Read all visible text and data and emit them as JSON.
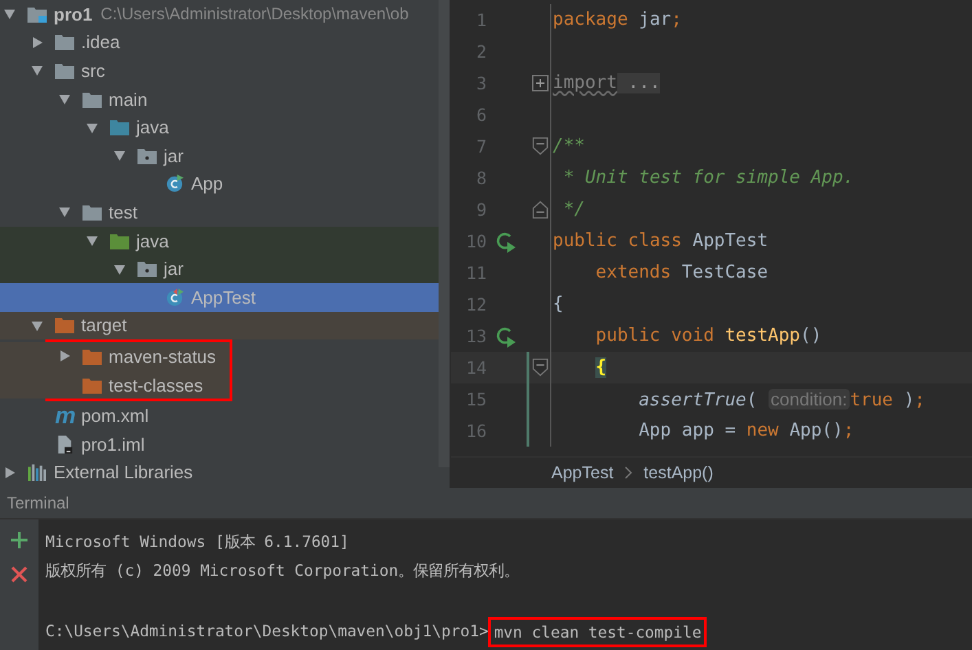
{
  "tree": [
    {
      "label": "pro1",
      "path": "C:\\Users\\Administrator\\Desktop\\maven\\ob",
      "kind": "module",
      "expanded": true,
      "selected": false,
      "children": [
        {
          "label": ".idea",
          "kind": "folder",
          "expanded": false,
          "selected": false
        },
        {
          "label": "src",
          "kind": "folder",
          "expanded": true,
          "selected": false,
          "children": [
            {
              "label": "main",
              "kind": "folder",
              "expanded": true,
              "selected": false,
              "children": [
                {
                  "label": "java",
                  "kind": "source-root",
                  "expanded": true,
                  "selected": false,
                  "children": [
                    {
                      "label": "jar",
                      "kind": "package",
                      "expanded": true,
                      "selected": false,
                      "children": [
                        {
                          "label": "App",
                          "kind": "class",
                          "selected": false
                        }
                      ]
                    }
                  ]
                }
              ]
            },
            {
              "label": "test",
              "kind": "folder",
              "expanded": true,
              "selected": false,
              "children": [
                {
                  "label": "java",
                  "kind": "test-root",
                  "expanded": true,
                  "selected": false,
                  "children": [
                    {
                      "label": "jar",
                      "kind": "package",
                      "expanded": true,
                      "selected": false,
                      "children": [
                        {
                          "label": "AppTest",
                          "kind": "test-class",
                          "selected": true
                        }
                      ]
                    }
                  ]
                }
              ]
            }
          ]
        },
        {
          "label": "target",
          "kind": "excluded",
          "expanded": true,
          "selected": false,
          "children": [
            {
              "label": "maven-status",
              "kind": "excluded",
              "expanded": false,
              "selected": false,
              "boxed": true
            },
            {
              "label": "test-classes",
              "kind": "excluded",
              "selected": false,
              "boxed": true
            }
          ]
        },
        {
          "label": "pom.xml",
          "kind": "maven",
          "glyph": "m",
          "selected": false
        },
        {
          "label": "pro1.iml",
          "kind": "file",
          "selected": false
        }
      ]
    },
    {
      "label": "External Libraries",
      "kind": "libraries",
      "expanded": false,
      "selected": false
    }
  ],
  "editor": {
    "lines": [
      {
        "number": "1",
        "run": false,
        "current": false,
        "changed": false,
        "tokens": [
          {
            "text": "package ",
            "kind": "keyword"
          },
          {
            "text": "jar",
            "kind": "plain"
          },
          {
            "text": ";",
            "kind": "keyword"
          }
        ]
      },
      {
        "number": "2",
        "run": false,
        "current": false,
        "changed": false
      },
      {
        "number": "3",
        "run": false,
        "current": false,
        "changed": false,
        "fold": {
          "kind": "collapsed"
        },
        "tokens": [
          {
            "text": "import",
            "kind": "unused"
          },
          {
            "text": " ...",
            "kind": "folded"
          }
        ]
      },
      {
        "number": "6",
        "run": false,
        "current": false,
        "changed": false
      },
      {
        "number": "7",
        "run": false,
        "current": false,
        "changed": false,
        "fold": {
          "kind": "start"
        },
        "tokens": [
          {
            "text": "/**",
            "kind": "doc"
          }
        ]
      },
      {
        "number": "8",
        "run": false,
        "current": false,
        "changed": false,
        "tokens": [
          {
            "text": " * Unit test for simple App.",
            "kind": "doc"
          }
        ]
      },
      {
        "number": "9",
        "run": false,
        "current": false,
        "changed": false,
        "fold": {
          "kind": "end"
        },
        "tokens": [
          {
            "text": " */",
            "kind": "doc"
          }
        ]
      },
      {
        "number": "10",
        "run": true,
        "current": false,
        "changed": false,
        "tokens": [
          {
            "text": "public class ",
            "kind": "keyword"
          },
          {
            "text": "AppTest",
            "kind": "plain"
          }
        ]
      },
      {
        "number": "11",
        "run": false,
        "current": false,
        "changed": false,
        "indent": {
          "kind": "member"
        },
        "tokens": [
          {
            "text": "extends ",
            "kind": "keyword"
          },
          {
            "text": "TestCase",
            "kind": "plain"
          }
        ]
      },
      {
        "number": "12",
        "run": false,
        "current": false,
        "changed": false,
        "tokens": [
          {
            "text": "{",
            "kind": "plain"
          }
        ]
      },
      {
        "number": "13",
        "run": true,
        "current": false,
        "changed": false,
        "indent": {
          "kind": "member"
        },
        "tokens": [
          {
            "text": "public void ",
            "kind": "keyword"
          },
          {
            "text": "testApp",
            "kind": "method"
          },
          {
            "text": "()",
            "kind": "plain"
          }
        ]
      },
      {
        "number": "14",
        "run": false,
        "current": true,
        "changed": true,
        "fold": {
          "kind": "start"
        },
        "indent": {
          "kind": "member"
        },
        "tokens": [
          {
            "text": "{",
            "kind": "brace-match"
          }
        ]
      },
      {
        "number": "15",
        "run": false,
        "current": false,
        "changed": true,
        "indent": {
          "kind": "body"
        },
        "tokens": [
          {
            "text": "assertTrue",
            "kind": "static"
          },
          {
            "text": "( ",
            "kind": "plain"
          },
          {
            "text": "condition:",
            "kind": "hint"
          },
          {
            "text": "true",
            "kind": "keyword"
          },
          {
            "text": " )",
            "kind": "plain"
          },
          {
            "text": ";",
            "kind": "keyword"
          }
        ]
      },
      {
        "number": "16",
        "run": false,
        "current": false,
        "changed": true,
        "indent": {
          "kind": "body"
        },
        "tokens": [
          {
            "text": "App app = ",
            "kind": "plain"
          },
          {
            "text": "new ",
            "kind": "keyword"
          },
          {
            "text": "App()",
            "kind": "plain"
          },
          {
            "text": ";",
            "kind": "keyword"
          }
        ]
      }
    ],
    "breadcrumbs": [
      "AppTest",
      "testApp()"
    ]
  },
  "terminal": {
    "title": "Terminal",
    "lines": [
      {
        "kind": "output",
        "text": "Microsoft Windows [版本 6.1.7601]"
      },
      {
        "kind": "output",
        "text": "版权所有 (c) 2009 Microsoft Corporation。保留所有权利。"
      },
      {
        "kind": "blank"
      },
      {
        "kind": "prompt",
        "prompt": "C:\\Users\\Administrator\\Desktop\\maven\\obj1\\pro1>",
        "command": "mvn clean test-compile",
        "boxed": true
      }
    ]
  }
}
